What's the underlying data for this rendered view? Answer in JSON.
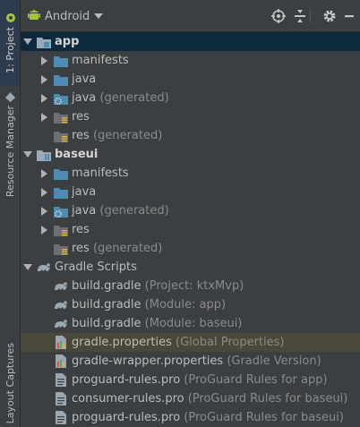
{
  "side_tabs": {
    "project": "1: Project",
    "resource_manager": "Resource Manager",
    "layout_captures": "Layout Captures"
  },
  "toolbar": {
    "view": "Android",
    "icons": [
      "target-icon",
      "collapse-all-icon",
      "gear-icon",
      "hide-icon"
    ]
  },
  "tree": [
    {
      "name": "app",
      "secondary": "",
      "level": 0,
      "expanded": true,
      "icon": "module-folder-icon",
      "bold": true,
      "selected": true
    },
    {
      "name": "manifests",
      "secondary": "",
      "level": 1,
      "expanded": false,
      "icon": "folder-icon"
    },
    {
      "name": "java",
      "secondary": "",
      "level": 1,
      "expanded": false,
      "icon": "folder-icon"
    },
    {
      "name": "java",
      "secondary": "(generated)",
      "level": 1,
      "expanded": false,
      "icon": "generated-folder-icon"
    },
    {
      "name": "res",
      "secondary": "",
      "level": 1,
      "expanded": false,
      "icon": "res-folder-icon"
    },
    {
      "name": "res",
      "secondary": "(generated)",
      "level": 1,
      "expanded": null,
      "icon": "res-folder-icon"
    },
    {
      "name": "baseui",
      "secondary": "",
      "level": 0,
      "expanded": true,
      "icon": "library-module-icon",
      "bold": true
    },
    {
      "name": "manifests",
      "secondary": "",
      "level": 1,
      "expanded": false,
      "icon": "folder-icon"
    },
    {
      "name": "java",
      "secondary": "",
      "level": 1,
      "expanded": false,
      "icon": "folder-icon"
    },
    {
      "name": "java",
      "secondary": "(generated)",
      "level": 1,
      "expanded": false,
      "icon": "generated-folder-icon"
    },
    {
      "name": "res",
      "secondary": "",
      "level": 1,
      "expanded": false,
      "icon": "res-folder-icon"
    },
    {
      "name": "res",
      "secondary": "(generated)",
      "level": 1,
      "expanded": null,
      "icon": "res-folder-icon"
    },
    {
      "name": "Gradle Scripts",
      "secondary": "",
      "level": 0,
      "expanded": true,
      "icon": "gradle-icon"
    },
    {
      "name": "build.gradle",
      "secondary": "(Project: ktxMvp)",
      "level": 1,
      "expanded": null,
      "icon": "gradle-file-icon"
    },
    {
      "name": "build.gradle",
      "secondary": "(Module: app)",
      "level": 1,
      "expanded": null,
      "icon": "gradle-file-icon"
    },
    {
      "name": "build.gradle",
      "secondary": "(Module: baseui)",
      "level": 1,
      "expanded": null,
      "icon": "gradle-file-icon"
    },
    {
      "name": "gradle.properties",
      "secondary": "(Global Properties)",
      "level": 1,
      "expanded": null,
      "icon": "properties-file-icon",
      "highlighted": true
    },
    {
      "name": "gradle-wrapper.properties",
      "secondary": "(Gradle Version)",
      "level": 1,
      "expanded": null,
      "icon": "properties-file-icon"
    },
    {
      "name": "proguard-rules.pro",
      "secondary": "(ProGuard Rules for app)",
      "level": 1,
      "expanded": null,
      "icon": "text-file-icon"
    },
    {
      "name": "consumer-rules.pro",
      "secondary": "(ProGuard Rules for baseui)",
      "level": 1,
      "expanded": null,
      "icon": "text-file-icon"
    },
    {
      "name": "proguard-rules.pro",
      "secondary": "(ProGuard Rules for baseui)",
      "level": 1,
      "expanded": null,
      "icon": "text-file-icon"
    }
  ],
  "colors": {
    "panel_bg": "#3c3f41",
    "selection": "#0d293e",
    "highlight": "#4a4838",
    "folder_blue": "#4d8bb3",
    "android_green": "#a4c639"
  }
}
